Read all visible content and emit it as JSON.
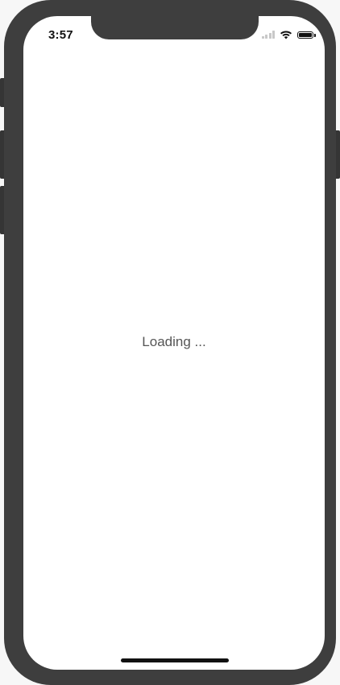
{
  "status_bar": {
    "time": "3:57",
    "icons": [
      "signal-icon",
      "wifi-icon",
      "battery-icon"
    ]
  },
  "main": {
    "loading_text": "Loading ..."
  },
  "colors": {
    "frame": "#3e3e3e",
    "screen": "#ffffff",
    "text": "#555555"
  }
}
